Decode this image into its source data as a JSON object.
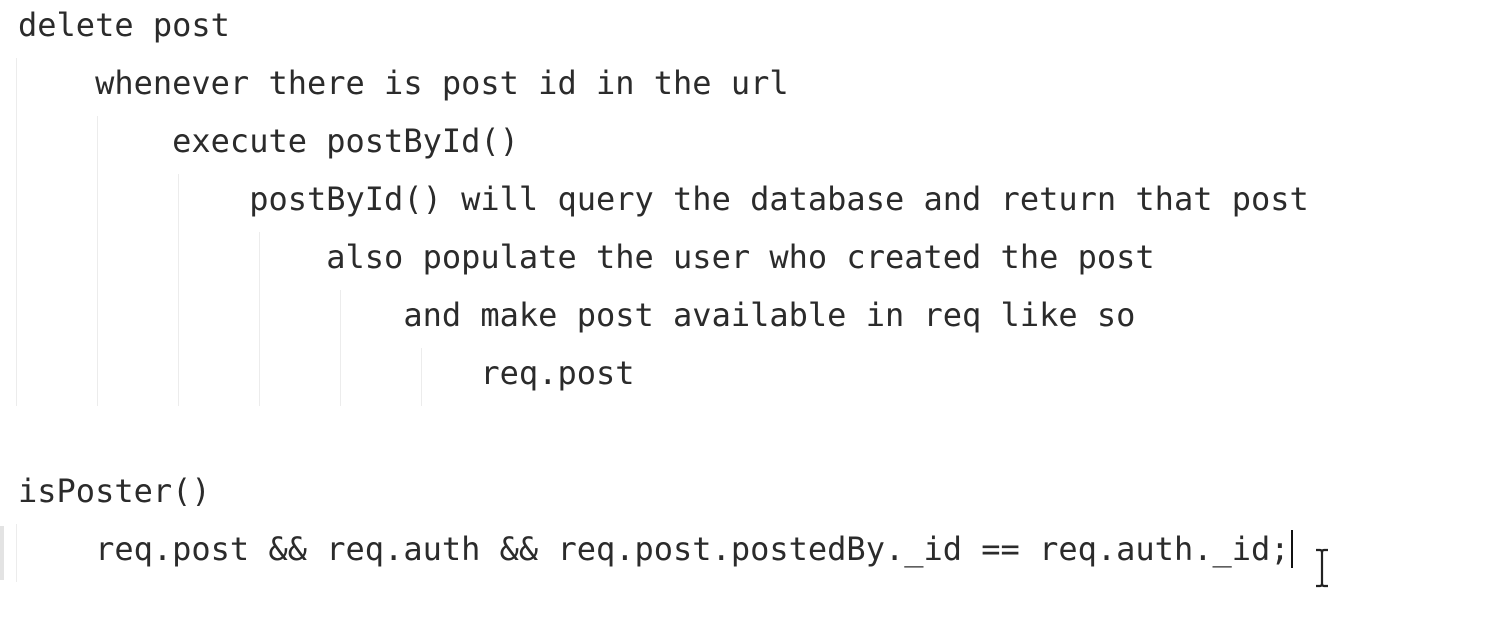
{
  "editor": {
    "lines": [
      "delete post",
      "    whenever there is post id in the url",
      "        execute postById()",
      "            postById() will query the database and return that post",
      "                also populate the user who created the post",
      "                    and make post available in req like so",
      "                        req.post",
      "",
      "isPoster()",
      "    req.post && req.auth && req.post.postedBy._id == req.auth._id;"
    ],
    "colors": {
      "text": "#2b2b2b",
      "background": "#ffffff",
      "guide": "#ececec",
      "caret": "#111111"
    },
    "icons": {
      "cursor": "text-cursor-icon",
      "pointer": "ibeam-pointer-icon"
    }
  }
}
